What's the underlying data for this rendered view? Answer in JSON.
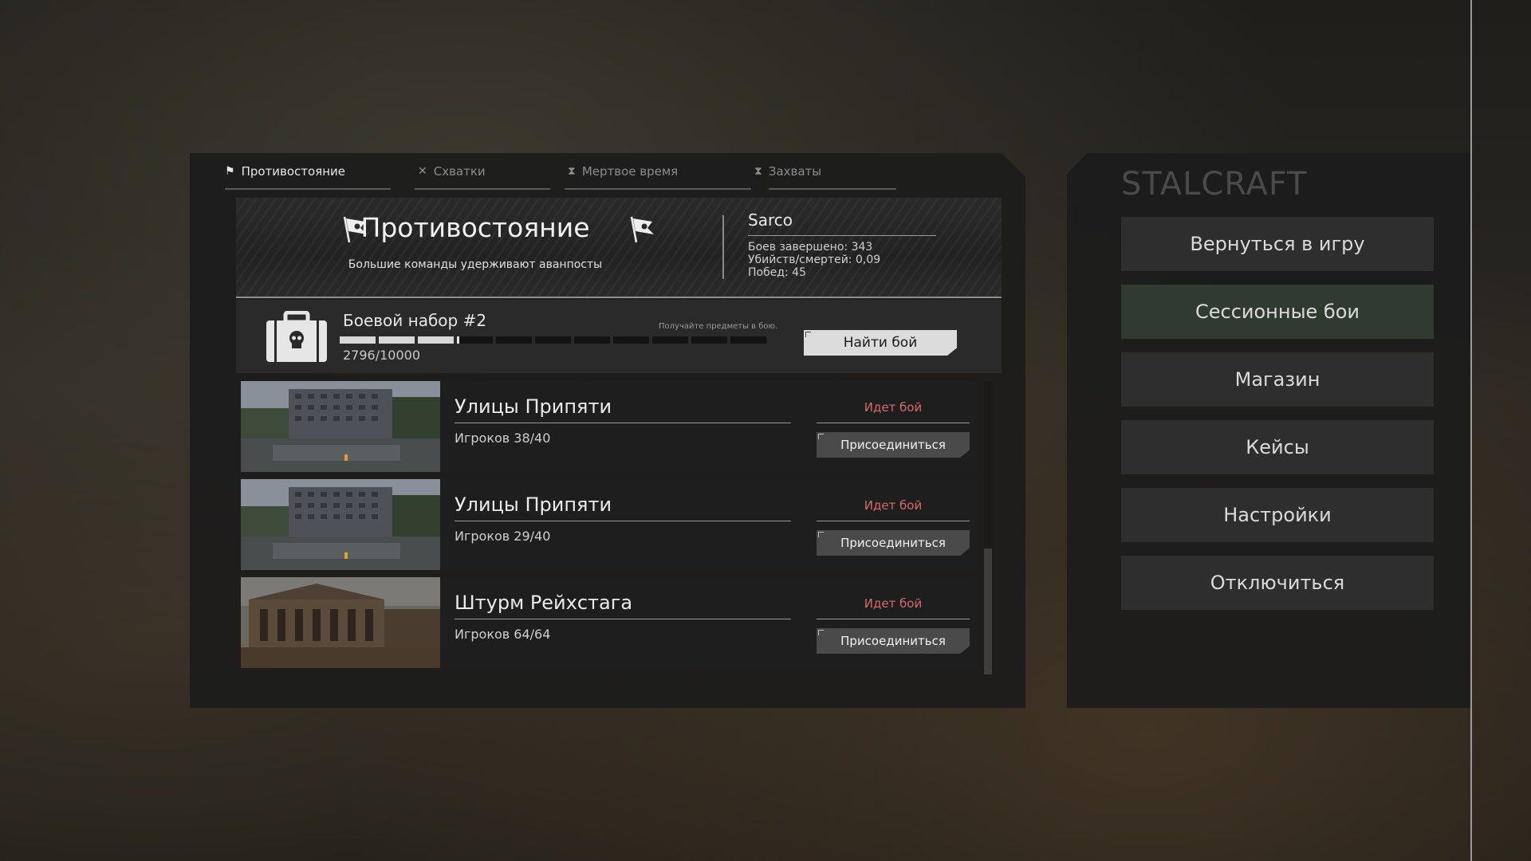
{
  "tabs": [
    {
      "label": "Противостояние",
      "icon": "flag-icon"
    },
    {
      "label": "Схватки",
      "icon": "crossed-swords-icon"
    },
    {
      "label": "Мертвое время",
      "icon": "hourglass-icon"
    },
    {
      "label": "Захваты",
      "icon": "hourglass-icon"
    }
  ],
  "mode": {
    "title": "Противостояние",
    "subtitle": "Большие команды удерживают аванпосты"
  },
  "player": {
    "name": "Sarco",
    "battles": "Боев завершено: 343",
    "kd": "Убийств/смертей: 0,09",
    "wins": "Побед: 45"
  },
  "kit": {
    "name": "Боевой набор #2",
    "hint": "Получайте предметы в бою.",
    "progress": "2796/10000",
    "progress_fraction": 0.2796,
    "segments_total": 11,
    "find_button": "Найти бой"
  },
  "servers": [
    {
      "name": "Улицы Припяти",
      "players": "Игроков 38/40",
      "status": "Идет бой",
      "join": "Присоединиться"
    },
    {
      "name": "Улицы Припяти",
      "players": "Игроков 29/40",
      "status": "Идет бой",
      "join": "Присоединиться"
    },
    {
      "name": "Штурм Рейхстага",
      "players": "Игроков 64/64",
      "status": "Идет бой",
      "join": "Присоединиться"
    }
  ],
  "menu": {
    "game_title": "STALCRAFT",
    "items": [
      "Вернуться в игру",
      "Сессионные бои",
      "Магазин",
      "Кейсы",
      "Настройки",
      "Отключиться"
    ],
    "active_index": 1
  },
  "colors": {
    "status_red": "#d86a6a",
    "active_green": "#5fbf3a"
  }
}
